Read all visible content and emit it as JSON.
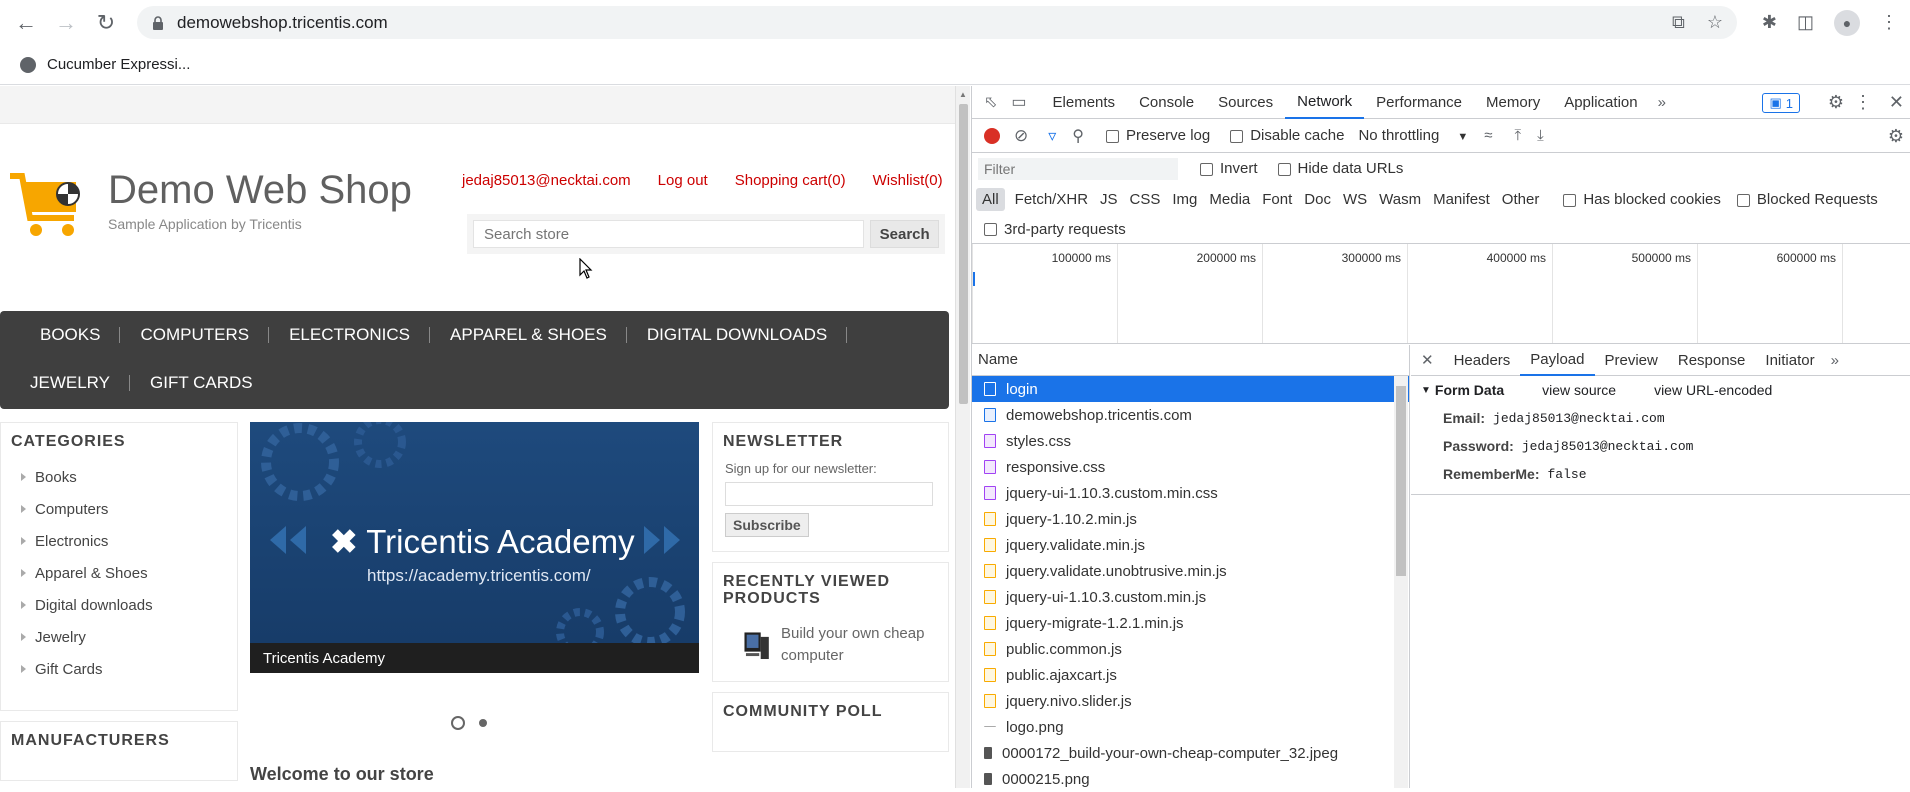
{
  "browser": {
    "url": "demowebshop.tricentis.com",
    "bookmark": "Cucumber Expressi..."
  },
  "shop": {
    "logo_title": "Demo Web Shop",
    "logo_subtitle": "Sample Application by Tricentis",
    "header_links": [
      "jedaj85013@necktai.com",
      "Log out",
      "Shopping cart(0)",
      "Wishlist(0)"
    ],
    "search_placeholder": "Search store",
    "search_button": "Search",
    "menu_row1": [
      "BOOKS",
      "COMPUTERS",
      "ELECTRONICS",
      "APPAREL & SHOES",
      "DIGITAL DOWNLOADS"
    ],
    "menu_row2": [
      "JEWELRY",
      "GIFT CARDS"
    ],
    "categories_title": "CATEGORIES",
    "categories": [
      "Books",
      "Computers",
      "Electronics",
      "Apparel & Shoes",
      "Digital downloads",
      "Jewelry",
      "Gift Cards"
    ],
    "manufacturers_title": "MANUFACTURERS",
    "banner_title": "Tricentis Academy",
    "banner_url": "https://academy.tricentis.com/",
    "banner_caption": "Tricentis Academy",
    "welcome": "Welcome to our store",
    "newsletter_title": "NEWSLETTER",
    "newsletter_label": "Sign up for our newsletter:",
    "subscribe": "Subscribe",
    "recently_viewed_title": "RECENTLY VIEWED PRODUCTS",
    "recent_item": "Build your own cheap computer",
    "poll_title": "COMMUNITY POLL"
  },
  "devtools": {
    "tabs": [
      "Elements",
      "Console",
      "Sources",
      "Network",
      "Performance",
      "Memory",
      "Application"
    ],
    "active_tab": "Network",
    "issues_count": "1",
    "preserve_log": "Preserve log",
    "disable_cache": "Disable cache",
    "throttling": "No throttling",
    "filter_placeholder": "Filter",
    "invert": "Invert",
    "hide_data_urls": "Hide data URLs",
    "filter_types": [
      "All",
      "Fetch/XHR",
      "JS",
      "CSS",
      "Img",
      "Media",
      "Font",
      "Doc",
      "WS",
      "Wasm",
      "Manifest",
      "Other"
    ],
    "has_blocked_cookies": "Has blocked cookies",
    "blocked_requests": "Blocked Requests",
    "third_party": "3rd-party requests",
    "timeline_ticks": [
      "100000 ms",
      "200000 ms",
      "300000 ms",
      "400000 ms",
      "500000 ms",
      "600000 ms"
    ],
    "name_header": "Name",
    "requests": [
      {
        "name": "login",
        "type": "doc"
      },
      {
        "name": "demowebshop.tricentis.com",
        "type": "doc"
      },
      {
        "name": "styles.css",
        "type": "css"
      },
      {
        "name": "responsive.css",
        "type": "css"
      },
      {
        "name": "jquery-ui-1.10.3.custom.min.css",
        "type": "css"
      },
      {
        "name": "jquery-1.10.2.min.js",
        "type": "js"
      },
      {
        "name": "jquery.validate.min.js",
        "type": "js"
      },
      {
        "name": "jquery.validate.unobtrusive.min.js",
        "type": "js"
      },
      {
        "name": "jquery-ui-1.10.3.custom.min.js",
        "type": "js"
      },
      {
        "name": "jquery-migrate-1.2.1.min.js",
        "type": "js"
      },
      {
        "name": "public.common.js",
        "type": "js"
      },
      {
        "name": "public.ajaxcart.js",
        "type": "js"
      },
      {
        "name": "jquery.nivo.slider.js",
        "type": "js"
      },
      {
        "name": "logo.png",
        "type": "img"
      },
      {
        "name": "0000172_build-your-own-cheap-computer_32.jpeg",
        "type": "jpg"
      },
      {
        "name": "0000215.png",
        "type": "jpg"
      }
    ],
    "detail_tabs": [
      "Headers",
      "Payload",
      "Preview",
      "Response",
      "Initiator"
    ],
    "active_detail_tab": "Payload",
    "form_data_title": "Form Data",
    "view_source": "view source",
    "view_url_encoded": "view URL-encoded",
    "form_data": [
      {
        "key": "Email:",
        "value": "jedaj85013@necktai.com"
      },
      {
        "key": "Password:",
        "value": "jedaj85013@necktai.com"
      },
      {
        "key": "RememberMe:",
        "value": "false"
      }
    ]
  }
}
